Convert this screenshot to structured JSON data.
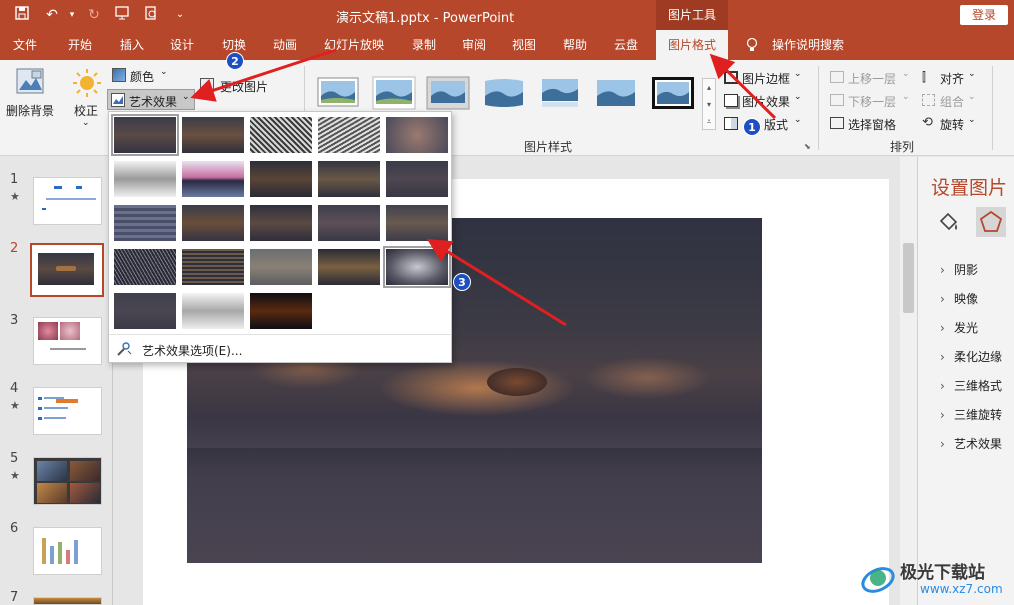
{
  "title_bar": {
    "doc_title": "演示文稿1.pptx  -  PowerPoint",
    "context_tab": "图片工具",
    "login": "登录"
  },
  "tabs": [
    {
      "label": "文件"
    },
    {
      "label": "开始"
    },
    {
      "label": "插入"
    },
    {
      "label": "设计"
    },
    {
      "label": "切换"
    },
    {
      "label": "动画"
    },
    {
      "label": "幻灯片放映"
    },
    {
      "label": "录制"
    },
    {
      "label": "审阅"
    },
    {
      "label": "视图"
    },
    {
      "label": "帮助"
    },
    {
      "label": "云盘"
    },
    {
      "label": "图片格式",
      "active": true
    }
  ],
  "tell_me": "操作说明搜索",
  "ribbon": {
    "remove_bg": "删除背景",
    "correct": "校正",
    "color": "颜色",
    "art_effects": "艺术效果",
    "change_picture": "更改图片",
    "picture_styles_label": "图片样式",
    "picture_border": "图片边框",
    "picture_effects": "图片效果",
    "picture_layout": "版式",
    "bring_forward": "上移一层",
    "send_backward": "下移一层",
    "selection_pane": "选择窗格",
    "align": "对齐",
    "group": "组合",
    "rotate": "旋转",
    "arrange_label": "排列"
  },
  "art_menu": {
    "options_label": "艺术效果选项(E)..."
  },
  "slides": [
    {
      "num": "1",
      "star": "★"
    },
    {
      "num": "2",
      "star": ""
    },
    {
      "num": "3",
      "star": ""
    },
    {
      "num": "4",
      "star": "★"
    },
    {
      "num": "5",
      "star": "★"
    },
    {
      "num": "6",
      "star": ""
    },
    {
      "num": "7",
      "star": ""
    }
  ],
  "format_pane": {
    "title": "设置图片",
    "items": [
      "阴影",
      "映像",
      "发光",
      "柔化边缘",
      "三维格式",
      "三维旋转",
      "艺术效果"
    ]
  },
  "annotations": [
    "1",
    "2",
    "3"
  ],
  "watermark": {
    "line1": "极光下载站",
    "line2": "www.xz7.com"
  },
  "colors": {
    "accent": "#b7472a",
    "badge": "#1e4fc2",
    "arrow": "#e02020"
  }
}
